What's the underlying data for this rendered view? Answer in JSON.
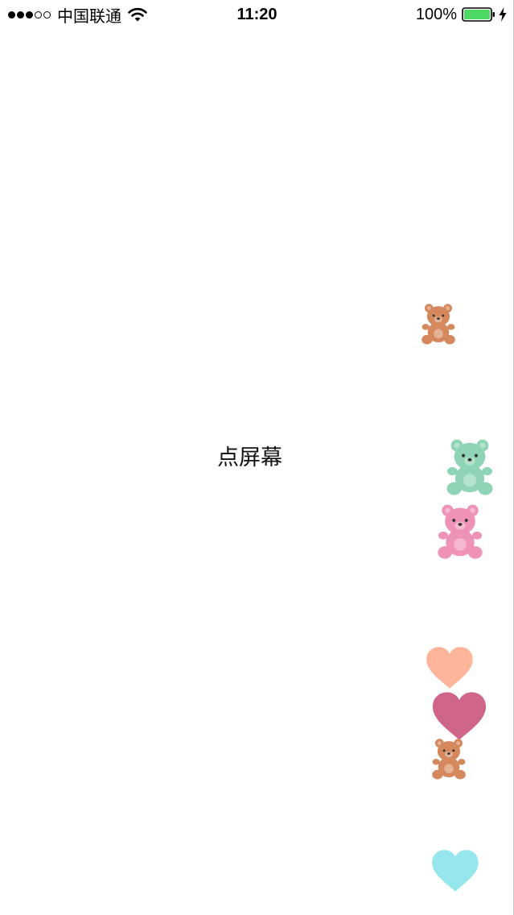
{
  "status_bar": {
    "signal_dots": [
      "filled",
      "filled",
      "filled",
      "empty",
      "empty"
    ],
    "carrier": "中国联通",
    "time": "11:20",
    "battery_percent": "100%",
    "battery_level": 1.0,
    "charging": true,
    "icons": [
      "signal-strength-icon",
      "wifi-icon",
      "battery-icon",
      "charging-bolt-icon"
    ]
  },
  "main": {
    "tap_hint": "点屏幕"
  },
  "floating_items": [
    {
      "kind": "bear",
      "color": "#d5885c"
    },
    {
      "kind": "bear",
      "color": "#8fd4b4"
    },
    {
      "kind": "bear",
      "color": "#ee92b8"
    },
    {
      "kind": "heart",
      "color": "#ffb59a"
    },
    {
      "kind": "heart",
      "color": "#d0658a"
    },
    {
      "kind": "bear",
      "color": "#d5885c"
    },
    {
      "kind": "heart",
      "color": "#96e6ee"
    }
  ],
  "colors": {
    "battery_fill": "#4cd964",
    "bear_brown": "#d5885c",
    "bear_green": "#8fd4b4",
    "bear_pink": "#ee92b8",
    "heart_peach": "#ffb59a",
    "heart_rose": "#d0658a",
    "heart_cyan": "#96e6ee"
  }
}
